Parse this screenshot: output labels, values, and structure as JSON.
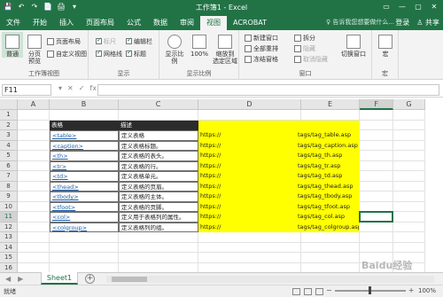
{
  "window": {
    "title": "工作簿1 - Excel",
    "qat": [
      "💾",
      "↶",
      "↷",
      "📄",
      "🖨",
      "▾"
    ],
    "controls": [
      "▭",
      "—",
      "▢",
      "✕"
    ]
  },
  "tabs": [
    "文件",
    "开始",
    "插入",
    "页面布局",
    "公式",
    "数据",
    "审阅",
    "视图",
    "ACROBAT"
  ],
  "active_tab": "视图",
  "tell_me": "♀ 告诉我您想要做什么...",
  "account": {
    "login": "登录",
    "share": "♙ 共享"
  },
  "ribbon": {
    "views": {
      "label": "工作簿视图",
      "normal": "普通",
      "page_break": "分页\n预览",
      "page_layout": "页面布局",
      "custom": "自定义视图"
    },
    "show": {
      "label": "显示",
      "ruler": "标尺",
      "formula_bar": "编辑栏",
      "gridlines": "网格线",
      "headings": "标题"
    },
    "zoom": {
      "label": "显示比例",
      "zoom": "显示比例",
      "hundred": "100%",
      "selection": "缩放到\n选定区域"
    },
    "window": {
      "label": "窗口",
      "new_window": "新建窗口",
      "arrange_all": "全部重排",
      "freeze": "冻结窗格",
      "split": "拆分",
      "hide": "隐藏",
      "unhide": "取消隐藏",
      "switch": "切换窗口"
    },
    "macros": {
      "label": "宏",
      "macro": "宏"
    }
  },
  "formula_bar": {
    "name_box": "F11",
    "icons": [
      "▾",
      "✕",
      "✓",
      "fx"
    ],
    "content": ""
  },
  "columns": [
    "A",
    "B",
    "C",
    "D",
    "E",
    "F",
    "G"
  ],
  "selected_col": "F",
  "rows": [
    "1",
    "2",
    "3",
    "4",
    "5",
    "6",
    "7",
    "8",
    "9",
    "10",
    "11",
    "12",
    "13",
    "14",
    "15",
    "16"
  ],
  "selected_row": "11",
  "table": {
    "header": [
      "表格",
      "描述"
    ],
    "rows": [
      {
        "tag": "<table>",
        "desc": "定义表格",
        "url": "https://",
        "path": "tags/tag_table.asp"
      },
      {
        "tag": "<caption>",
        "desc": "定义表格标题。",
        "url": "https://",
        "path": "tags/tag_caption.asp"
      },
      {
        "tag": "<th>",
        "desc": "定义表格的表头。",
        "url": "https://",
        "path": "tags/tag_th.asp"
      },
      {
        "tag": "<tr>",
        "desc": "定义表格的行。",
        "url": "https://",
        "path": "tags/tag_tr.asp"
      },
      {
        "tag": "<td>",
        "desc": "定义表格单元。",
        "url": "https://",
        "path": "tags/tag_td.asp"
      },
      {
        "tag": "<thead>",
        "desc": "定义表格的页眉。",
        "url": "https://",
        "path": "tags/tag_thead.asp"
      },
      {
        "tag": "<tbody>",
        "desc": "定义表格的主体。",
        "url": "https://",
        "path": "tags/tag_tbody.asp"
      },
      {
        "tag": "<tfoot>",
        "desc": "定义表格的页脚。",
        "url": "https://",
        "path": "tags/tag_tfoot.asp"
      },
      {
        "tag": "<col>",
        "desc": "定义用于表格列的属性。",
        "url": "https://",
        "path": "tags/tag_col.asp"
      },
      {
        "tag": "<colgroup>",
        "desc": "定义表格列的组。",
        "url": "https://",
        "path": "tags/tag_colgroup.asp"
      }
    ]
  },
  "sheets": [
    "Sheet1"
  ],
  "nav_arrows": [
    "◀",
    "▶"
  ],
  "add_sheet": "+",
  "status": {
    "ready": "就绪",
    "zoom_percent": "100%",
    "zoom_minus": "−",
    "zoom_plus": "+"
  },
  "watermark": "Baidu经验",
  "colors": {
    "brand": "#217346",
    "highlight": "#ffff00",
    "header_bg": "#2b2b2b",
    "link": "#1f5fa8"
  }
}
